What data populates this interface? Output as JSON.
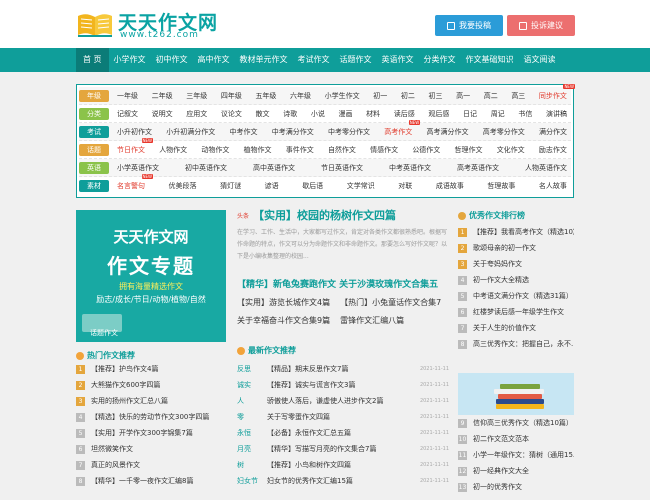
{
  "header": {
    "logo_title": "天天作文网",
    "logo_url": "www.t262.com",
    "submit_label": "我要投稿",
    "feedback_label": "投诉建议"
  },
  "nav": [
    "首 页",
    "小学作文",
    "初中作文",
    "高中作文",
    "教材单元作文",
    "考试作文",
    "话题作文",
    "英语作文",
    "分类作文",
    "作文基础知识",
    "语文阅读"
  ],
  "categories": [
    {
      "label": "年级",
      "color": "#e4a63d",
      "links": [
        "一年级",
        "二年级",
        "三年级",
        "四年级",
        "五年级",
        "六年级",
        "小学生作文",
        "初一",
        "初二",
        "初三",
        "高一",
        "高二",
        "高三",
        "同步作文"
      ],
      "hot": [
        13
      ]
    },
    {
      "label": "分类",
      "color": "#8bc34a",
      "links": [
        "记叙文",
        "说明文",
        "应用文",
        "议论文",
        "散文",
        "诗歌",
        "小说",
        "漫画",
        "材料",
        "读后感",
        "观后感",
        "日记",
        "周记",
        "书信",
        "演讲稿"
      ],
      "hot": []
    },
    {
      "label": "考试",
      "color": "#0f9e9a",
      "links": [
        "小升初作文",
        "小升初满分作文",
        "中考作文",
        "中考满分作文",
        "中考零分作文",
        "高考作文",
        "高考满分作文",
        "高考零分作文",
        "满分作文"
      ],
      "hot": [
        5
      ]
    },
    {
      "label": "话题",
      "color": "#e4a63d",
      "links": [
        "节日作文",
        "人物作文",
        "动物作文",
        "植物作文",
        "事件作文",
        "自然作文",
        "情感作文",
        "公德作文",
        "哲理作文",
        "文化作文",
        "励志作文"
      ],
      "hot": [
        0
      ]
    },
    {
      "label": "英语",
      "color": "#8bc34a",
      "links": [
        "小学英语作文",
        "初中英语作文",
        "高中英语作文",
        "节日英语作文",
        "中考英语作文",
        "高考英语作文",
        "人物英语作文"
      ],
      "hot": []
    },
    {
      "label": "素材",
      "color": "#0f9e9a",
      "links": [
        "名言警句",
        "优美段落",
        "猜灯谜",
        "谚语",
        "歇后语",
        "文学常识",
        "对联",
        "成语故事",
        "哲理故事",
        "名人故事"
      ],
      "hot": [
        0
      ]
    }
  ],
  "banner": {
    "line1": "天天作文网",
    "line2": "作文专题",
    "line3": "拥有海量精选作文",
    "line4": "励志/成长/节日/动物/植物/自然",
    "tag": "话题作文"
  },
  "hot_section": {
    "title": "热门作文推荐",
    "items": [
      "【推荐】护鸟作文4篇",
      "大熊猫作文600字四篇",
      "实用的扬州作文汇总八篇",
      "【精选】快乐的劳动节作文300字四篇",
      "【实用】开学作文300字锦集7篇",
      "坦然微笑作文",
      "真正的风景作文",
      "【精华】一千零一夜作文汇编8篇"
    ]
  },
  "headline": {
    "tag": "头条",
    "title": "【实用】校园的杨树作文四篇",
    "summary": "在学习、工作、生活中，大家都写过作文，肯定对各类作文都很熟悉吧。根据写作命题的特点，作文可以分为命题作文和非命题作文。那要怎么写好作文呢？以下是小编收集整理的校园..."
  },
  "featured": {
    "title": "【精华】新龟兔赛跑作文 关于沙漠玫瑰作文合集五",
    "pairs": [
      [
        "【实用】游览长城作文4篇",
        "【热门】小兔童话作文合集7"
      ],
      [
        "关于幸福奋斗作文合集9篇",
        "雷锋作文汇编八篇"
      ]
    ]
  },
  "latest": {
    "title": "最新作文推荐",
    "rows": [
      {
        "cat": "反思",
        "title": "【精品】期末反思作文7篇",
        "date": "2021-11-11"
      },
      {
        "cat": "诚实",
        "title": "【推荐】诚实与谎言作文3篇",
        "date": "2021-11-11"
      },
      {
        "cat": "人",
        "title": "骄傲使人落后，谦虚使人进步作文2篇",
        "date": "2021-11-11"
      },
      {
        "cat": "零",
        "title": "关于写零蛋作文四篇",
        "date": "2021-11-11"
      },
      {
        "cat": "永恒",
        "title": "【必备】永恒作文汇总五篇",
        "date": "2021-11-11"
      },
      {
        "cat": "月亮",
        "title": "【精华】写描写月亮的作文集合7篇",
        "date": "2021-11-11"
      },
      {
        "cat": "树",
        "title": "【推荐】小鸟和树作文四篇",
        "date": "2021-11-11"
      },
      {
        "cat": "妇女节",
        "title": "妇女节的优秀作文汇编15篇",
        "date": "2021-11-11"
      }
    ]
  },
  "ranking": {
    "title": "优秀作文排行榜",
    "items": [
      "【推荐】我看高考作文（精选10篇）",
      "歌颂母亲的初一作文",
      "关于夸妈妈作文",
      "初一作文大全精选",
      "中考语文满分作文（精选31篇）",
      "红楼梦读后感一年级学生作文",
      "关于人生的价值作文",
      "高三优秀作文：把握自己，永不...",
      "信仰高三优秀作文（精选10篇）",
      "初二作文范文范本",
      "小学一年级作文：猜树（通用15...",
      "初一经典作文大全",
      "初一的优秀作文"
    ]
  }
}
